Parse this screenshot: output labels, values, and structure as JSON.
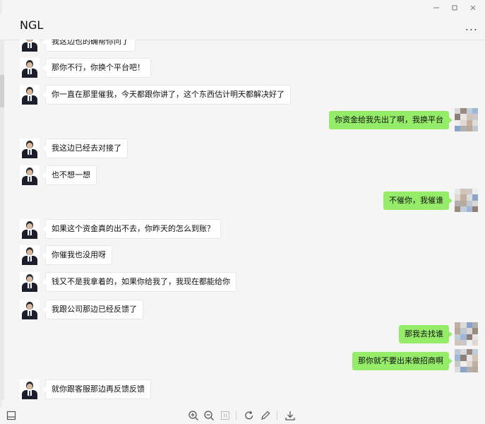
{
  "window": {
    "title": "NGL",
    "more_label": "...",
    "controls": [
      "minimize-icon",
      "maximize-icon",
      "close-icon"
    ]
  },
  "colors": {
    "outgoing_bubble": "#95ec69",
    "incoming_bubble": "#ffffff",
    "background": "#f5f5f5"
  },
  "messages": [
    {
      "from": "contact",
      "text": "我这边也的确帮你问了"
    },
    {
      "from": "contact",
      "text": "那你不行，你换个平台吧！"
    },
    {
      "from": "contact",
      "text": "你一直在那里催我，今天都跟你讲了，这个东西估计明天都解决好了"
    },
    {
      "from": "me",
      "text": "你资金给我先出了啊，我换平台"
    },
    {
      "from": "contact",
      "text": "我这边已经去对接了"
    },
    {
      "from": "contact",
      "text": "也不想一想"
    },
    {
      "from": "me",
      "text": "不催你，我催谁"
    },
    {
      "from": "contact",
      "text": "如果这个资金真的出不去，你昨天的怎么到账？"
    },
    {
      "from": "contact",
      "text": "你催我也没用呀"
    },
    {
      "from": "contact",
      "text": "钱又不是我拿着的，如果你给我了，我现在都能给你"
    },
    {
      "from": "contact",
      "text": "我跟公司那边已经反馈了"
    },
    {
      "from": "me",
      "text": "那我去找谁"
    },
    {
      "from": "me",
      "text": "那你就不要出来做招商啊"
    },
    {
      "from": "contact",
      "text": "就你跟客服那边再反馈反馈"
    }
  ],
  "toolbar": {
    "icons": [
      "sidebar-toggle-icon",
      "zoom-in-icon",
      "zoom-out-icon",
      "fit-page-icon",
      "rotate-icon",
      "edit-icon",
      "download-icon"
    ]
  }
}
